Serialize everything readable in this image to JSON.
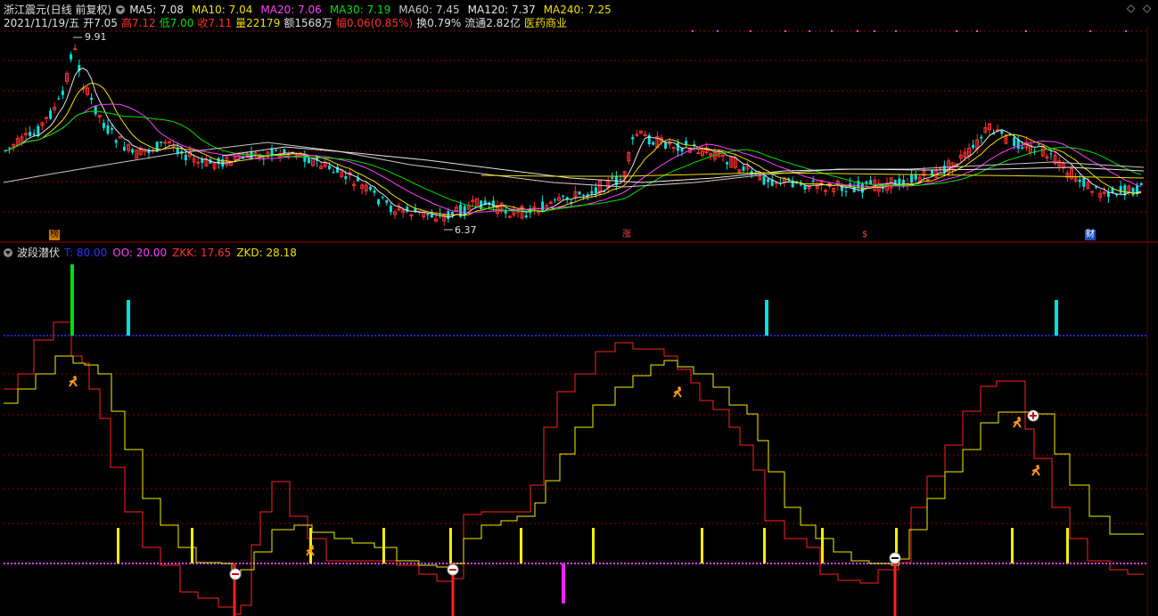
{
  "header": {
    "stock_name": "浙江震元(日线 前复权)",
    "ma": [
      {
        "label": "MA5: 7.08",
        "color": "#e6e6e6"
      },
      {
        "label": "MA10: 7.04",
        "color": "#f0e000"
      },
      {
        "label": "MA20: 7.06",
        "color": "#ff40ff"
      },
      {
        "label": "MA30: 7.19",
        "color": "#00e000"
      },
      {
        "label": "MA60: 7.45",
        "color": "#c8c8c8"
      },
      {
        "label": "MA120: 7.37",
        "color": "#e6e6e6"
      },
      {
        "label": "MA240: 7.25",
        "color": "#f0e000"
      }
    ]
  },
  "quote": {
    "date": "2021/11/19/五",
    "open": "开7.05",
    "high": "高7.12",
    "low": "低7.00",
    "close": "收7.11",
    "volume": "量22179",
    "amount": "额1568万",
    "change": "幅0.06(0.85%)",
    "turnover": "换0.79%",
    "float_cap": "流通2.82亿",
    "sector": "医药商业"
  },
  "price_labels": {
    "high": "9.91",
    "low": "6.37"
  },
  "event_markers": [
    {
      "text": "榜",
      "bg": "#c87800",
      "fg": "#000000"
    },
    {
      "text": "涨",
      "bg": "#000000",
      "fg": "#ff4040"
    },
    {
      "text": "$",
      "bg": "#000000",
      "fg": "#ff4040"
    },
    {
      "text": "财",
      "bg": "#2050c0",
      "fg": "#ffffff"
    }
  ],
  "indicator": {
    "name": "波段潜伏",
    "values": [
      {
        "label": "T: 80.00",
        "color": "#3030ff"
      },
      {
        "label": "OO: 20.00",
        "color": "#ff40ff"
      },
      {
        "label": "ZKK: 17.65",
        "color": "#ff3030"
      },
      {
        "label": "ZKD: 28.18",
        "color": "#f0e000"
      }
    ]
  },
  "colors": {
    "up": "#ff3030",
    "down": "#00e0e0",
    "grid": "#8b0000",
    "upper_line": "#3030ff",
    "lower_line": "#ff40ff",
    "zkk": "#ff2020",
    "zkd": "#f0f000"
  },
  "icons": [
    "dropdown-circle-icon",
    "diamond-icon",
    "dot-icon",
    "running-person-icon",
    "plus-circle-icon",
    "minus-circle-icon"
  ]
}
